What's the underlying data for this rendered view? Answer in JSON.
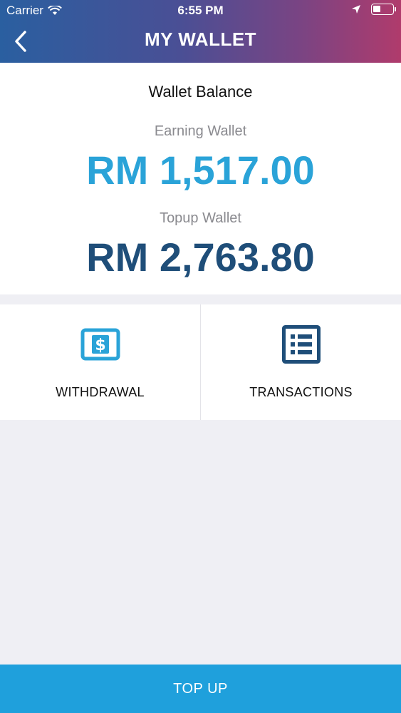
{
  "status_bar": {
    "carrier": "Carrier",
    "time": "6:55 PM"
  },
  "header": {
    "title": "MY WALLET",
    "back_icon": "chevron-left-icon"
  },
  "balance": {
    "title": "Wallet Balance",
    "earning_label": "Earning Wallet",
    "earning_value": "RM 1,517.00",
    "topup_label": "Topup Wallet",
    "topup_value": "RM 2,763.80"
  },
  "actions": [
    {
      "label": "WITHDRAWAL",
      "icon": "dollar-bill-icon"
    },
    {
      "label": "TRANSACTIONS",
      "icon": "list-icon"
    }
  ],
  "footer": {
    "topup_label": "TOP UP"
  },
  "colors": {
    "earning_accent": "#2aa3d8",
    "topup_accent": "#1f4e79",
    "button": "#1fa0dc"
  }
}
